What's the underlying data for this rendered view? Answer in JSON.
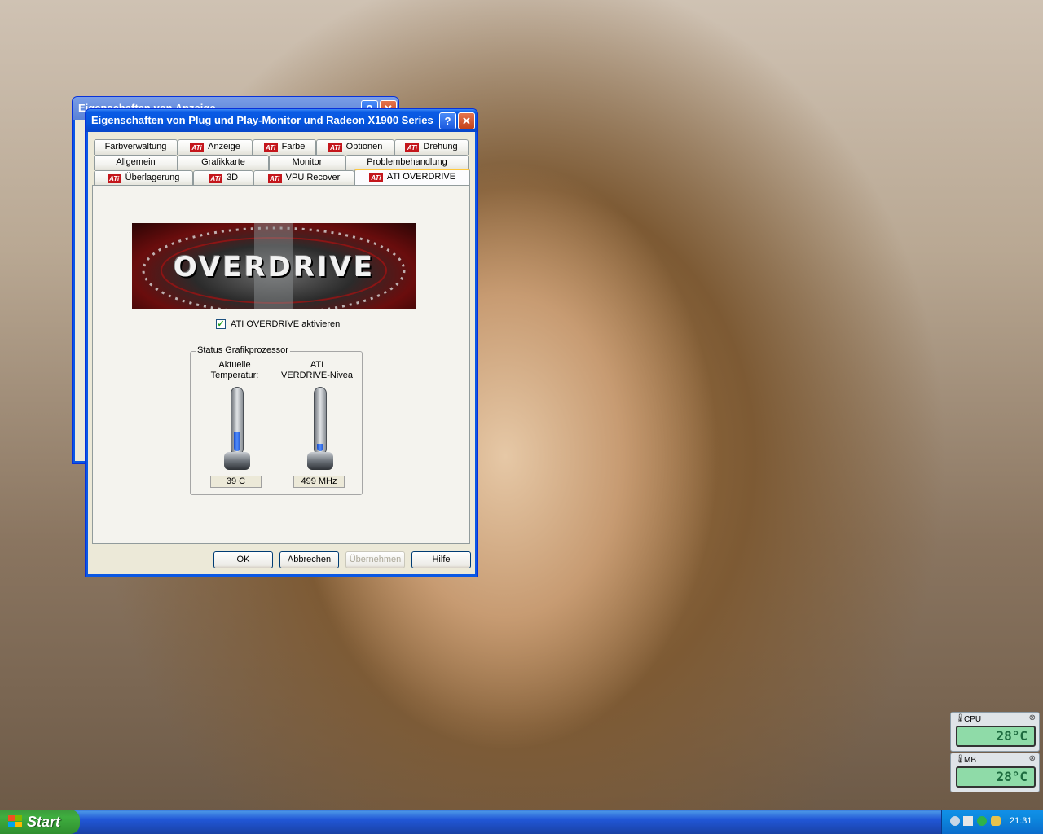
{
  "back_window": {
    "title": "Eigenschaften von Anzeige"
  },
  "dialog": {
    "title": "Eigenschaften von Plug und Play-Monitor und Radeon X1900 Series",
    "help_btn": "?",
    "close_btn": "✕",
    "tabs_row1": [
      "Farbverwaltung",
      "Anzeige",
      "Farbe",
      "Optionen",
      "Drehung"
    ],
    "tabs_row2": [
      "Allgemein",
      "Grafikkarte",
      "Monitor",
      "Problembehandlung"
    ],
    "tabs_row3": [
      "Überlagerung",
      "3D",
      "VPU Recover",
      "ATI OVERDRIVE"
    ],
    "ati_logo": "ATi",
    "banner_text": "OVERDRIVE",
    "checkbox_label": "ATI OVERDRIVE aktivieren",
    "checkbox_checked": true,
    "group_title": "Status Grafikprozessor",
    "temp_label_1": "Aktuelle",
    "temp_label_2": "Temperatur:",
    "level_label_1": "ATI",
    "level_label_2": "VERDRIVE-Nivea",
    "temp_value": "39 C",
    "clock_value": "499 MHz",
    "temp_fill_fraction": 0.3,
    "clock_fill_fraction": 0.12,
    "buttons": {
      "ok": "OK",
      "cancel": "Abbrechen",
      "apply": "Übernehmen",
      "help": "Hilfe"
    }
  },
  "gadgets": [
    {
      "label": "CPU",
      "value": "28°C"
    },
    {
      "label": "MB",
      "value": "28°C"
    }
  ],
  "taskbar": {
    "start": "Start",
    "clock": "21:31"
  }
}
